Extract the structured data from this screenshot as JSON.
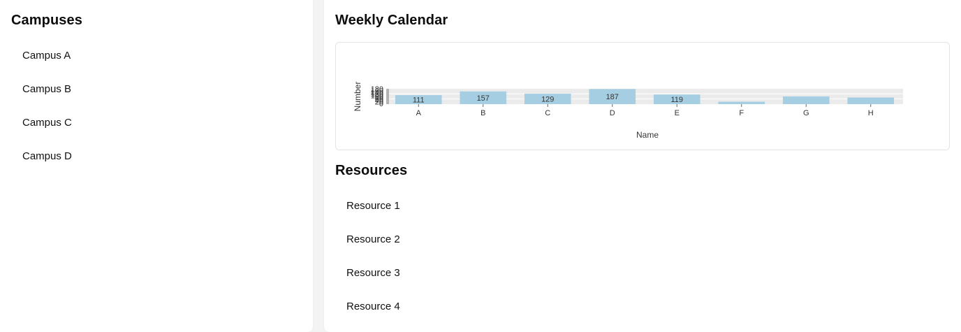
{
  "campuses": {
    "title": "Campuses",
    "items": [
      {
        "label": "Campus A"
      },
      {
        "label": "Campus B"
      },
      {
        "label": "Campus C"
      },
      {
        "label": "Campus D"
      }
    ]
  },
  "calendar": {
    "title": "Weekly Calendar"
  },
  "resources": {
    "title": "Resources",
    "items": [
      {
        "label": "Resource 1"
      },
      {
        "label": "Resource 2"
      },
      {
        "label": "Resource 3"
      },
      {
        "label": "Resource 4"
      }
    ]
  },
  "colors": {
    "bar": "#a6cee3",
    "grid_bg": "#ebebeb",
    "y_axis_marker": "#b3b3b3"
  },
  "chart_data": {
    "type": "bar",
    "xlabel": "Name",
    "ylabel": "Number",
    "categories": [
      "A",
      "B",
      "C",
      "D",
      "E",
      "F",
      "G",
      "H"
    ],
    "values": [
      111,
      157,
      129,
      187,
      119,
      30,
      95,
      82
    ],
    "value_labels": [
      "111",
      "157",
      "129",
      "187",
      "119",
      "",
      "",
      ""
    ],
    "ylim": [
      0,
      190
    ],
    "y_ticks": [
      "0",
      "20",
      "40",
      "60",
      "80",
      "100",
      "120",
      "140",
      "160",
      "180"
    ],
    "grid": true
  }
}
